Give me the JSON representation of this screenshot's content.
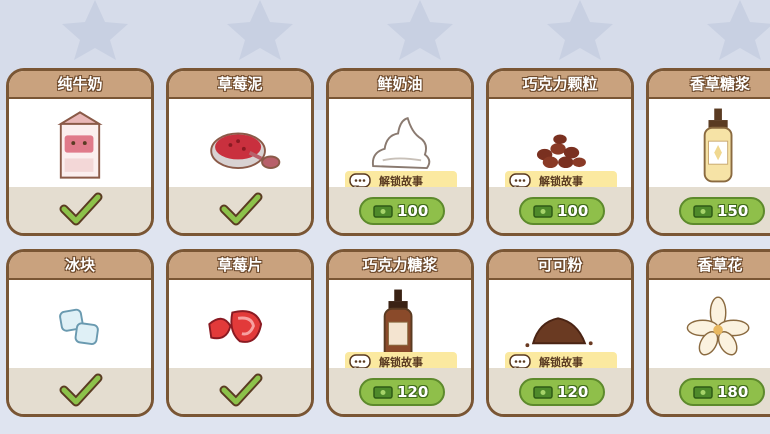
{
  "colors": {
    "background": "#dfe4f0",
    "card_border": "#7a5634",
    "title_bar": "#c9a27e",
    "buy_button": "#8fbf4a",
    "check": "#8cc24a"
  },
  "items": [
    {
      "name": "纯牛奶",
      "icon": "milk-carton-icon",
      "owned": true
    },
    {
      "name": "草莓泥",
      "icon": "strawberry-puree-icon",
      "owned": true
    },
    {
      "name": "鲜奶油",
      "icon": "whipped-cream-icon",
      "owned": false,
      "story_label": "解锁故事",
      "price": "100"
    },
    {
      "name": "巧克力颗粒",
      "icon": "chocolate-chips-icon",
      "owned": false,
      "story_label": "解锁故事",
      "price": "100"
    },
    {
      "name": "香草糖浆",
      "icon": "vanilla-syrup-bottle-icon",
      "owned": false,
      "price": "150"
    },
    {
      "name": "冰块",
      "icon": "ice-cubes-icon",
      "owned": true
    },
    {
      "name": "草莓片",
      "icon": "strawberry-slices-icon",
      "owned": true
    },
    {
      "name": "巧克力糖浆",
      "icon": "chocolate-syrup-bottle-icon",
      "owned": false,
      "story_label": "解锁故事",
      "price": "120"
    },
    {
      "name": "可可粉",
      "icon": "cocoa-powder-icon",
      "owned": false,
      "story_label": "解锁故事",
      "price": "120"
    },
    {
      "name": "香草花",
      "icon": "vanilla-flower-icon",
      "owned": false,
      "price": "180"
    }
  ]
}
